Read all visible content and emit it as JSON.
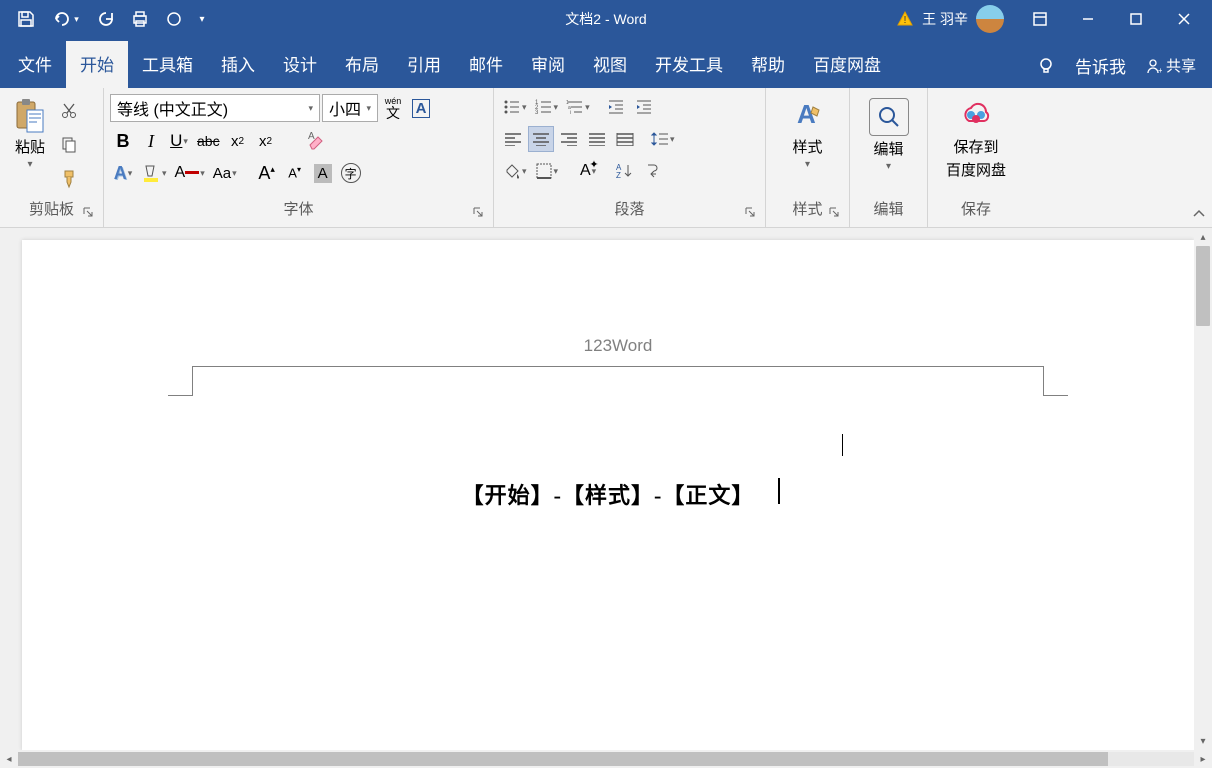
{
  "titlebar": {
    "doc_title": "文档2 - Word",
    "user_name": "王 羽辛"
  },
  "tabs": {
    "file": "文件",
    "home": "开始",
    "toolbox": "工具箱",
    "insert": "插入",
    "design": "设计",
    "layout": "布局",
    "references": "引用",
    "mailings": "邮件",
    "review": "审阅",
    "view": "视图",
    "developer": "开发工具",
    "help": "帮助",
    "baidu": "百度网盘",
    "tell_me": "告诉我",
    "share": "共享"
  },
  "ribbon": {
    "clipboard": {
      "label": "剪贴板",
      "paste": "粘贴"
    },
    "font": {
      "label": "字体",
      "name": "等线 (中文正文)",
      "size": "小四"
    },
    "paragraph": {
      "label": "段落"
    },
    "styles": {
      "label": "样式",
      "button": "样式"
    },
    "editing": {
      "label": "编辑",
      "button": "编辑"
    },
    "save": {
      "label": "保存",
      "button_l1": "保存到",
      "button_l2": "百度网盘"
    }
  },
  "document": {
    "header_text": "123Word",
    "body_text": "【开始】-【样式】-【正文】"
  }
}
